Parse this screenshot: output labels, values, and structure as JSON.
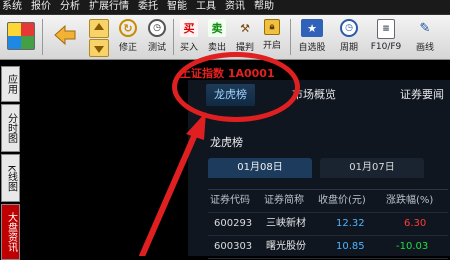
{
  "menu": [
    "系统",
    "报价",
    "分析",
    "扩展行情",
    "委托",
    "智能",
    "工具",
    "资讯",
    "帮助"
  ],
  "toolbar": {
    "back_label": "",
    "up_label": "",
    "down_label": "",
    "modify_label": "修正",
    "test_label": "测试",
    "buy_label": "买入",
    "buy_icon_char": "买",
    "sell_label": "卖出",
    "sell_icon_char": "卖",
    "auction_label": "撮判",
    "lock_label": "开启",
    "self_select_label": "自选股",
    "period_label": "周期",
    "f10_label": "F10/F9",
    "draw_label": "画线"
  },
  "left_tabs": [
    "应用",
    "分时图",
    "K线图",
    "大盘资讯"
  ],
  "market_title": "上证指数 1A0001",
  "top_tabs": [
    "龙虎榜",
    "市场概览",
    "证券要闻"
  ],
  "section_title": "龙虎榜",
  "date_tabs": [
    "01月08日",
    "01月07日"
  ],
  "table": {
    "headers": [
      "证券代码",
      "证券简称",
      "收盘价(元)",
      "涨跌幅(%)"
    ],
    "rows": [
      {
        "code": "600293",
        "name": "三峡新材",
        "close": "12.32",
        "change": "6.30"
      },
      {
        "code": "600303",
        "name": "曙光股份",
        "close": "10.85",
        "change": "-10.03"
      }
    ]
  },
  "colors": {
    "highlight_red": "#e02020",
    "up_red": "#ff3b3b",
    "down_green": "#22dd44",
    "price_blue": "#4fb3ff"
  }
}
